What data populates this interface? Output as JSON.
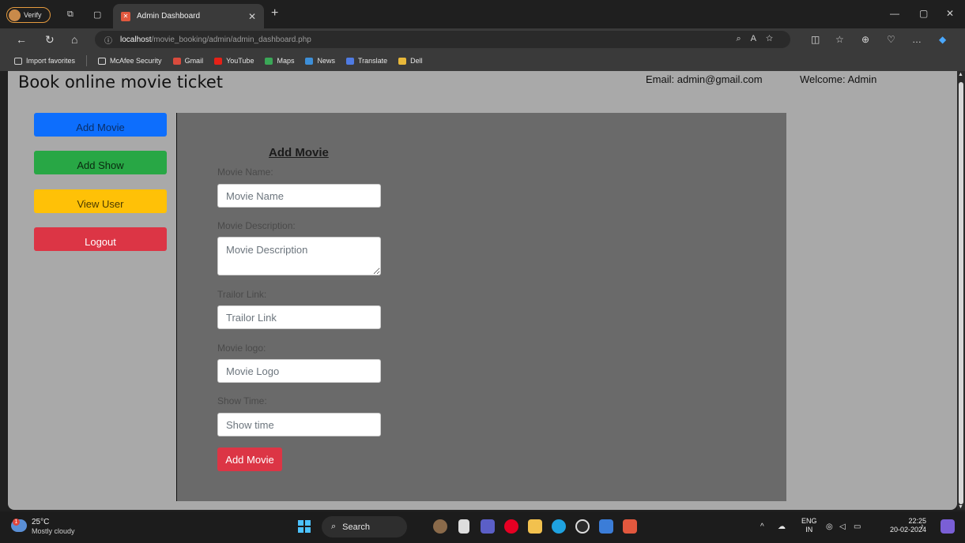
{
  "browser": {
    "profile_label": "Verify",
    "tab_title": "Admin Dashboard",
    "url_host": "localhost",
    "url_path": "/movie_booking/admin/admin_dashboard.php",
    "bookmarks": [
      "Import favorites",
      "McAfee Security",
      "Gmail",
      "YouTube",
      "Maps",
      "News",
      "Translate",
      "Dell"
    ]
  },
  "header": {
    "site_title": "Book online movie ticket",
    "email": "Email: admin@gmail.com",
    "welcome": "Welcome: Admin"
  },
  "sidebar": {
    "buttons": [
      {
        "label": "Add Movie",
        "color": "#0d6efd"
      },
      {
        "label": "Add Show",
        "color": "#28a745"
      },
      {
        "label": "View User",
        "color": "#ffc107"
      },
      {
        "label": "Logout",
        "color": "#dc3545"
      }
    ]
  },
  "form": {
    "title": "Add Movie",
    "fields": [
      {
        "label": "Movie Name:",
        "placeholder": "Movie Name"
      },
      {
        "label": "Movie Description:",
        "placeholder": "Movie Description"
      },
      {
        "label": "Trailor Link:",
        "placeholder": "Trailor Link"
      },
      {
        "label": "Movie logo:",
        "placeholder": "Movie Logo"
      },
      {
        "label": "Show Time:",
        "placeholder": "Show time"
      }
    ],
    "submit_label": "Add Movie"
  },
  "taskbar": {
    "temperature": "25°C",
    "weather": "Mostly cloudy",
    "search_label": "Search",
    "lang_top": "ENG",
    "lang_bottom": "IN",
    "time": "22:25",
    "date": "20-02-2024"
  }
}
